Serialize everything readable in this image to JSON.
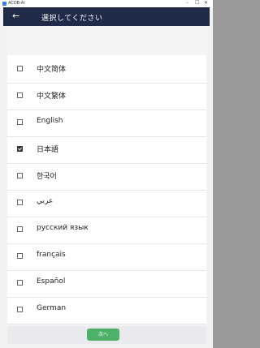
{
  "window": {
    "title": "ACDB-AI",
    "controls": {
      "minimize": "–",
      "maximize": "☐",
      "close": "✕"
    }
  },
  "header": {
    "back_icon": "arrow-left-icon",
    "title": "選択してください"
  },
  "languages": [
    {
      "label": "中文简体",
      "checked": false
    },
    {
      "label": "中文繁体",
      "checked": false
    },
    {
      "label": "English",
      "checked": false
    },
    {
      "label": "日本語",
      "checked": true
    },
    {
      "label": "한국어",
      "checked": false
    },
    {
      "label": "عربي",
      "checked": false
    },
    {
      "label": "русский язык",
      "checked": false
    },
    {
      "label": "français",
      "checked": false
    },
    {
      "label": "Español",
      "checked": false
    },
    {
      "label": "German",
      "checked": false
    }
  ],
  "footer": {
    "next_label": "次へ"
  },
  "colors": {
    "header_bg": "#1f2b49",
    "next_button": "#4fb06a"
  }
}
